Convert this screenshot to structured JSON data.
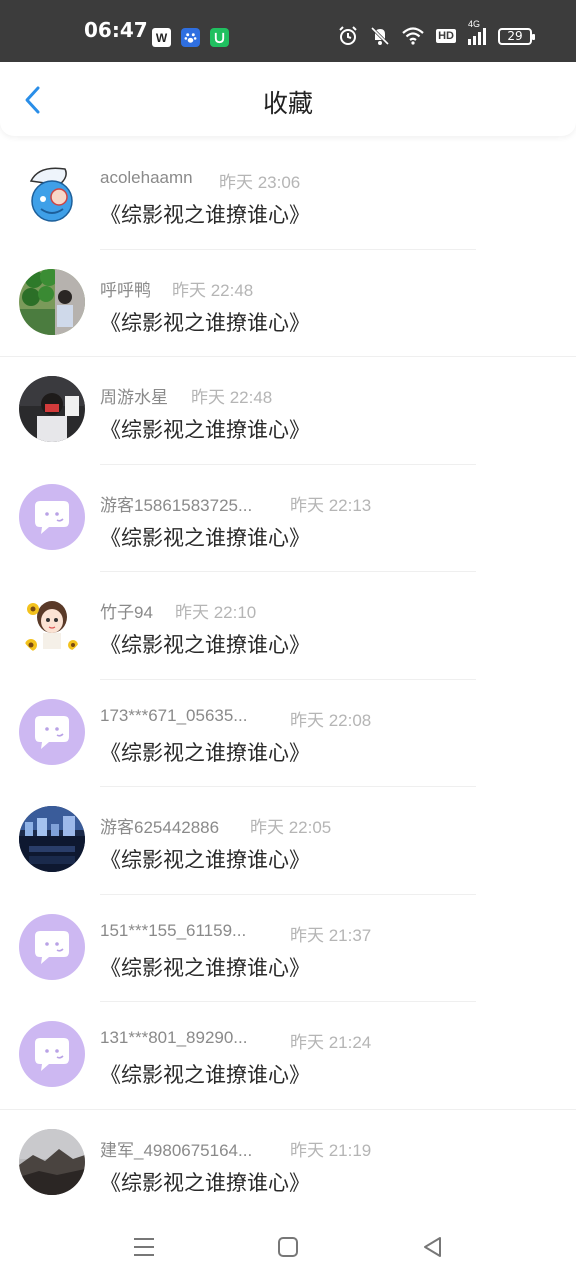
{
  "status_bar": {
    "time": "06:47",
    "apps": [
      {
        "icon": "wps-app-icon",
        "glyph": "W"
      },
      {
        "icon": "baidu-app-icon",
        "glyph": "🐾"
      },
      {
        "icon": "green-app-icon",
        "glyph": "⊌"
      }
    ],
    "network": "4G",
    "hd": "HD",
    "battery": "29"
  },
  "header": {
    "title": "收藏",
    "back_icon": "chevron-left-icon",
    "accent_color": "#2a8ee8"
  },
  "items": [
    {
      "name": "acolehaamn",
      "time": "昨天 23:06",
      "content": "《综影视之谁撩谁心》",
      "avatar": "cartoon-avatar"
    },
    {
      "name": "呼呼鸭",
      "time": "昨天 22:48",
      "content": "《综影视之谁撩谁心》",
      "avatar": "photo-avatar-green"
    },
    {
      "name": "周游水星",
      "time": "昨天 22:48",
      "content": "《综影视之谁撩谁心》",
      "avatar": "photo-avatar-dark"
    },
    {
      "name": "游客15861583725...",
      "time": "昨天 22:13",
      "content": "《综影视之谁撩谁心》",
      "avatar": "default-chat-avatar"
    },
    {
      "name": "竹子94",
      "time": "昨天 22:10",
      "content": "《综影视之谁撩谁心》",
      "avatar": "sunflower-girl-avatar"
    },
    {
      "name": "173***671_05635...",
      "time": "昨天 22:08",
      "content": "《综影视之谁撩谁心》",
      "avatar": "default-chat-avatar"
    },
    {
      "name": "游客625442886",
      "time": "昨天 22:05",
      "content": "《综影视之谁撩谁心》",
      "avatar": "city-photo-avatar"
    },
    {
      "name": "151***155_61159...",
      "time": "昨天 21:37",
      "content": "《综影视之谁撩谁心》",
      "avatar": "default-chat-avatar"
    },
    {
      "name": "131***801_89290...",
      "time": "昨天 21:24",
      "content": "《综影视之谁撩谁心》",
      "avatar": "default-chat-avatar"
    },
    {
      "name": "建军_4980675164...",
      "time": "昨天 21:19",
      "content": "《综影视之谁撩谁心》",
      "avatar": "mountain-photo-avatar"
    }
  ],
  "nav_bar": {
    "menu_icon": "menu-icon",
    "home_icon": "home-square-icon",
    "back_icon": "back-triangle-icon"
  },
  "colors": {
    "default_avatar_bg": "#cdb8f2",
    "status_bar_bg": "#3c3c3c"
  }
}
